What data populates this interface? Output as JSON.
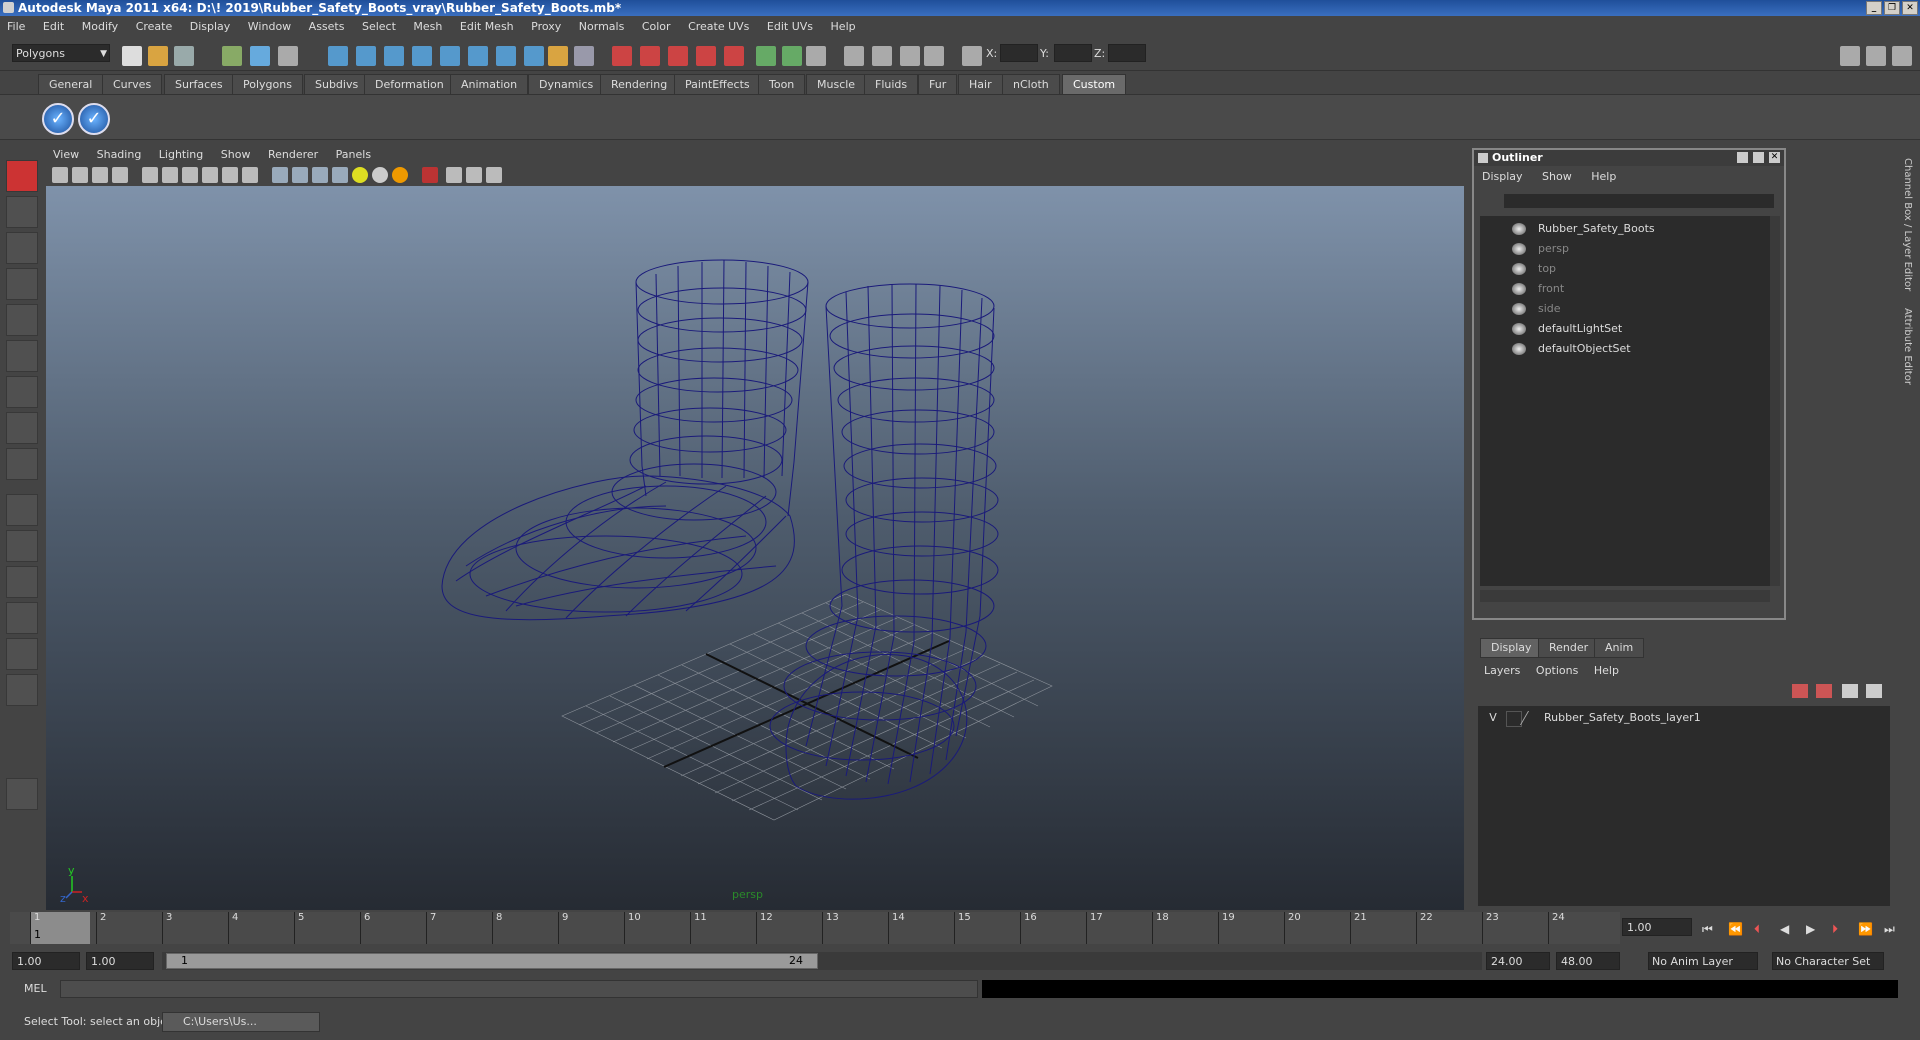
{
  "window": {
    "title": "Autodesk Maya 2011 x64: D:\\! 2019\\Rubber_Safety_Boots_vray\\Rubber_Safety_Boots.mb*"
  },
  "menubar": [
    "File",
    "Edit",
    "Modify",
    "Create",
    "Display",
    "Window",
    "Assets",
    "Select",
    "Mesh",
    "Edit Mesh",
    "Proxy",
    "Normals",
    "Color",
    "Create UVs",
    "Edit UVs",
    "Help"
  ],
  "statusline": {
    "mode": "Polygons",
    "coord_labels": [
      "X:",
      "Y:",
      "Z:"
    ]
  },
  "shelf_tabs": [
    "General",
    "Curves",
    "Surfaces",
    "Polygons",
    "Subdivs",
    "Deformation",
    "Animation",
    "Dynamics",
    "Rendering",
    "PaintEffects",
    "Toon",
    "Muscle",
    "Fluids",
    "Fur",
    "Hair",
    "nCloth",
    "Custom"
  ],
  "active_shelf": "Custom",
  "viewport": {
    "menu": [
      "View",
      "Shading",
      "Lighting",
      "Show",
      "Renderer",
      "Panels"
    ],
    "camera_label": "persp",
    "axis_y": "y",
    "axis_z": "z",
    "axis_x": "x"
  },
  "outliner": {
    "title": "Outliner",
    "menu": [
      "Display",
      "Show",
      "Help"
    ],
    "items": [
      {
        "label": "Rubber_Safety_Boots",
        "dim": false
      },
      {
        "label": "persp",
        "dim": true
      },
      {
        "label": "top",
        "dim": true
      },
      {
        "label": "front",
        "dim": true
      },
      {
        "label": "side",
        "dim": true
      },
      {
        "label": "defaultLightSet",
        "dim": false
      },
      {
        "label": "defaultObjectSet",
        "dim": false
      }
    ]
  },
  "side_tabs": [
    "Channel Box / Layer Editor",
    "Attribute Editor"
  ],
  "layer_editor": {
    "tabs": [
      "Display",
      "Render",
      "Anim"
    ],
    "menu": [
      "Layers",
      "Options",
      "Help"
    ],
    "layer_visible": "V",
    "layer_name": "Rubber_Safety_Boots_layer1"
  },
  "timeline": {
    "ticks": [
      "1",
      "2",
      "3",
      "4",
      "5",
      "6",
      "7",
      "8",
      "9",
      "10",
      "11",
      "12",
      "13",
      "14",
      "15",
      "16",
      "17",
      "18",
      "19",
      "20",
      "21",
      "22",
      "23",
      "24"
    ],
    "current_frame": "1.00",
    "current_marker": "1"
  },
  "range": {
    "start": "1.00",
    "playback_start": "1.00",
    "slider_start": "1",
    "slider_end": "24",
    "playback_end": "24.00",
    "end": "48.00",
    "anim_layer": "No Anim Layer",
    "character_set": "No Character Set"
  },
  "command": {
    "label": "MEL"
  },
  "help": {
    "text": "Select Tool: select an object",
    "task": "C:\\Users\\Us..."
  }
}
